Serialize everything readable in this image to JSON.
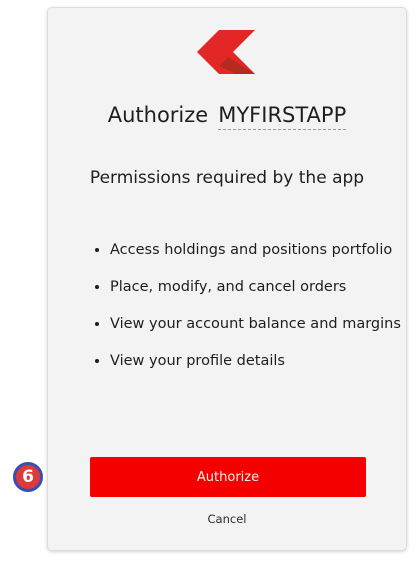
{
  "brand": {
    "logo_icon": "kite-logo-icon",
    "primary_color": "#f50000",
    "logo_colors": [
      "#e32626",
      "#b32a1e"
    ]
  },
  "title": {
    "prefix": "Authorize",
    "app_name": "MYFIRSTAPP"
  },
  "subtitle": "Permissions required by the app",
  "permissions": [
    "Access holdings and positions portfolio",
    "Place, modify, and cancel orders",
    "View your account balance and margins",
    "View your profile details"
  ],
  "actions": {
    "authorize_label": "Authorize",
    "cancel_label": "Cancel"
  },
  "step_badge": {
    "number": "6",
    "color": "#dd3b3b",
    "border_color": "#3a4db3"
  }
}
